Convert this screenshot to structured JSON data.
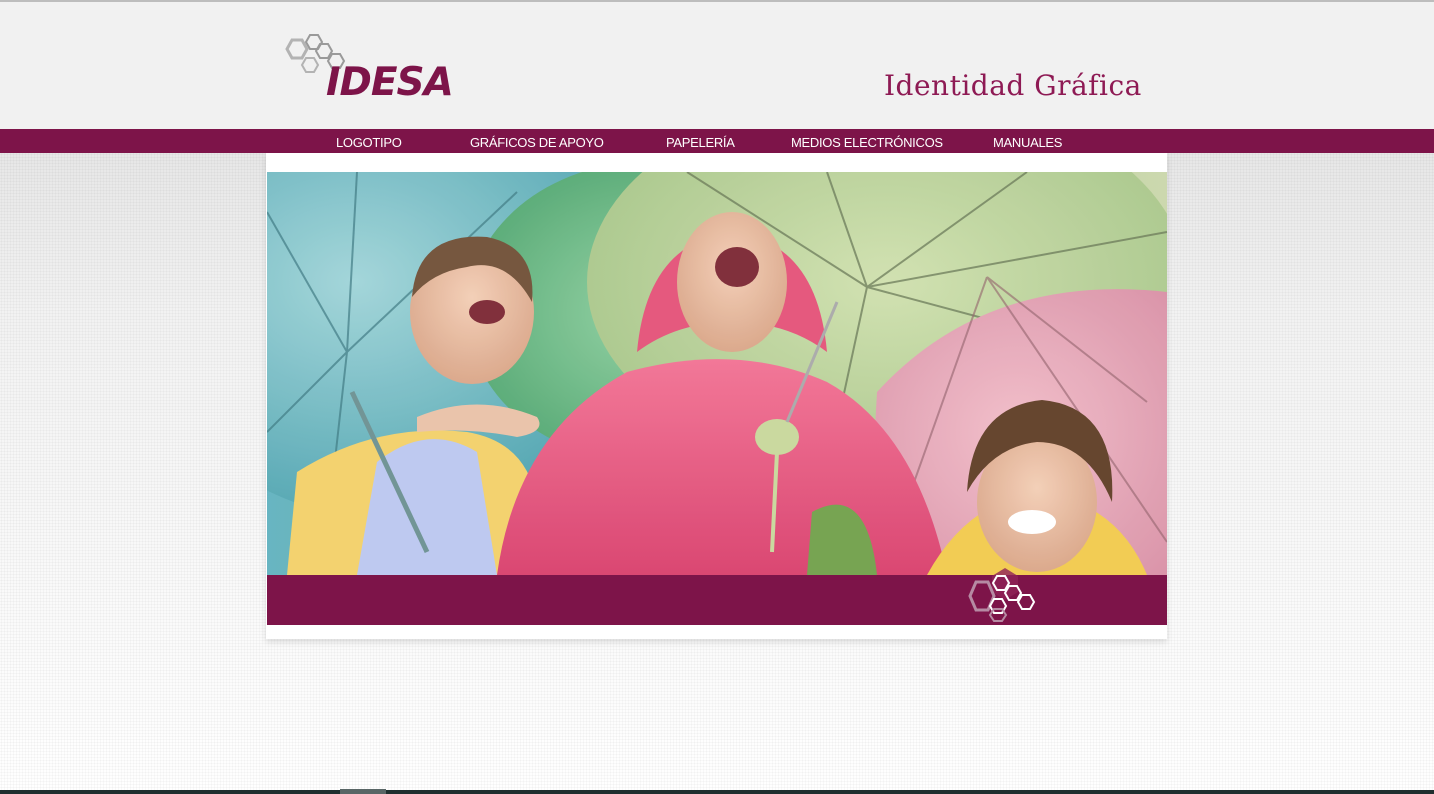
{
  "header": {
    "logo_text": "IDESA",
    "tagline": "Identidad Gráfica"
  },
  "nav": {
    "items": [
      {
        "label": "LOGOTIPO"
      },
      {
        "label": "GRÁFICOS DE APOYO"
      },
      {
        "label": "PAPELERÍA"
      },
      {
        "label": "MEDIOS ELECTRÓNICOS"
      },
      {
        "label": "MANUALES"
      }
    ]
  },
  "hero": {
    "icons": [
      "umbrella-icon",
      "child-icon",
      "hexagon-logo-icon"
    ]
  },
  "colors": {
    "brand": "#7d1449",
    "header_bg": "#f1f1f1",
    "tagline": "#8e1a54",
    "nav_text": "#ffffff"
  }
}
